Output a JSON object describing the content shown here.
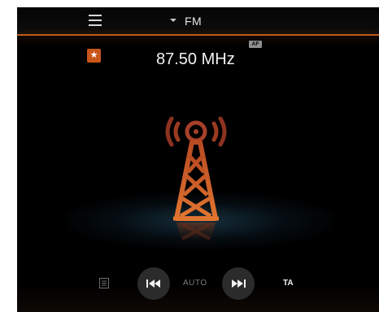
{
  "header": {
    "source_label": "FM"
  },
  "station": {
    "frequency": "87.50 MHz",
    "af_badge": "AF",
    "favorite_icon": "star-icon"
  },
  "controls": {
    "auto_label": "AUTO",
    "ta_label": "TA",
    "prev_icon": "skip-previous-icon",
    "next_icon": "skip-next-icon",
    "list_icon": "station-list-icon"
  },
  "colors": {
    "accent": "#c8551a",
    "background": "#000000"
  }
}
